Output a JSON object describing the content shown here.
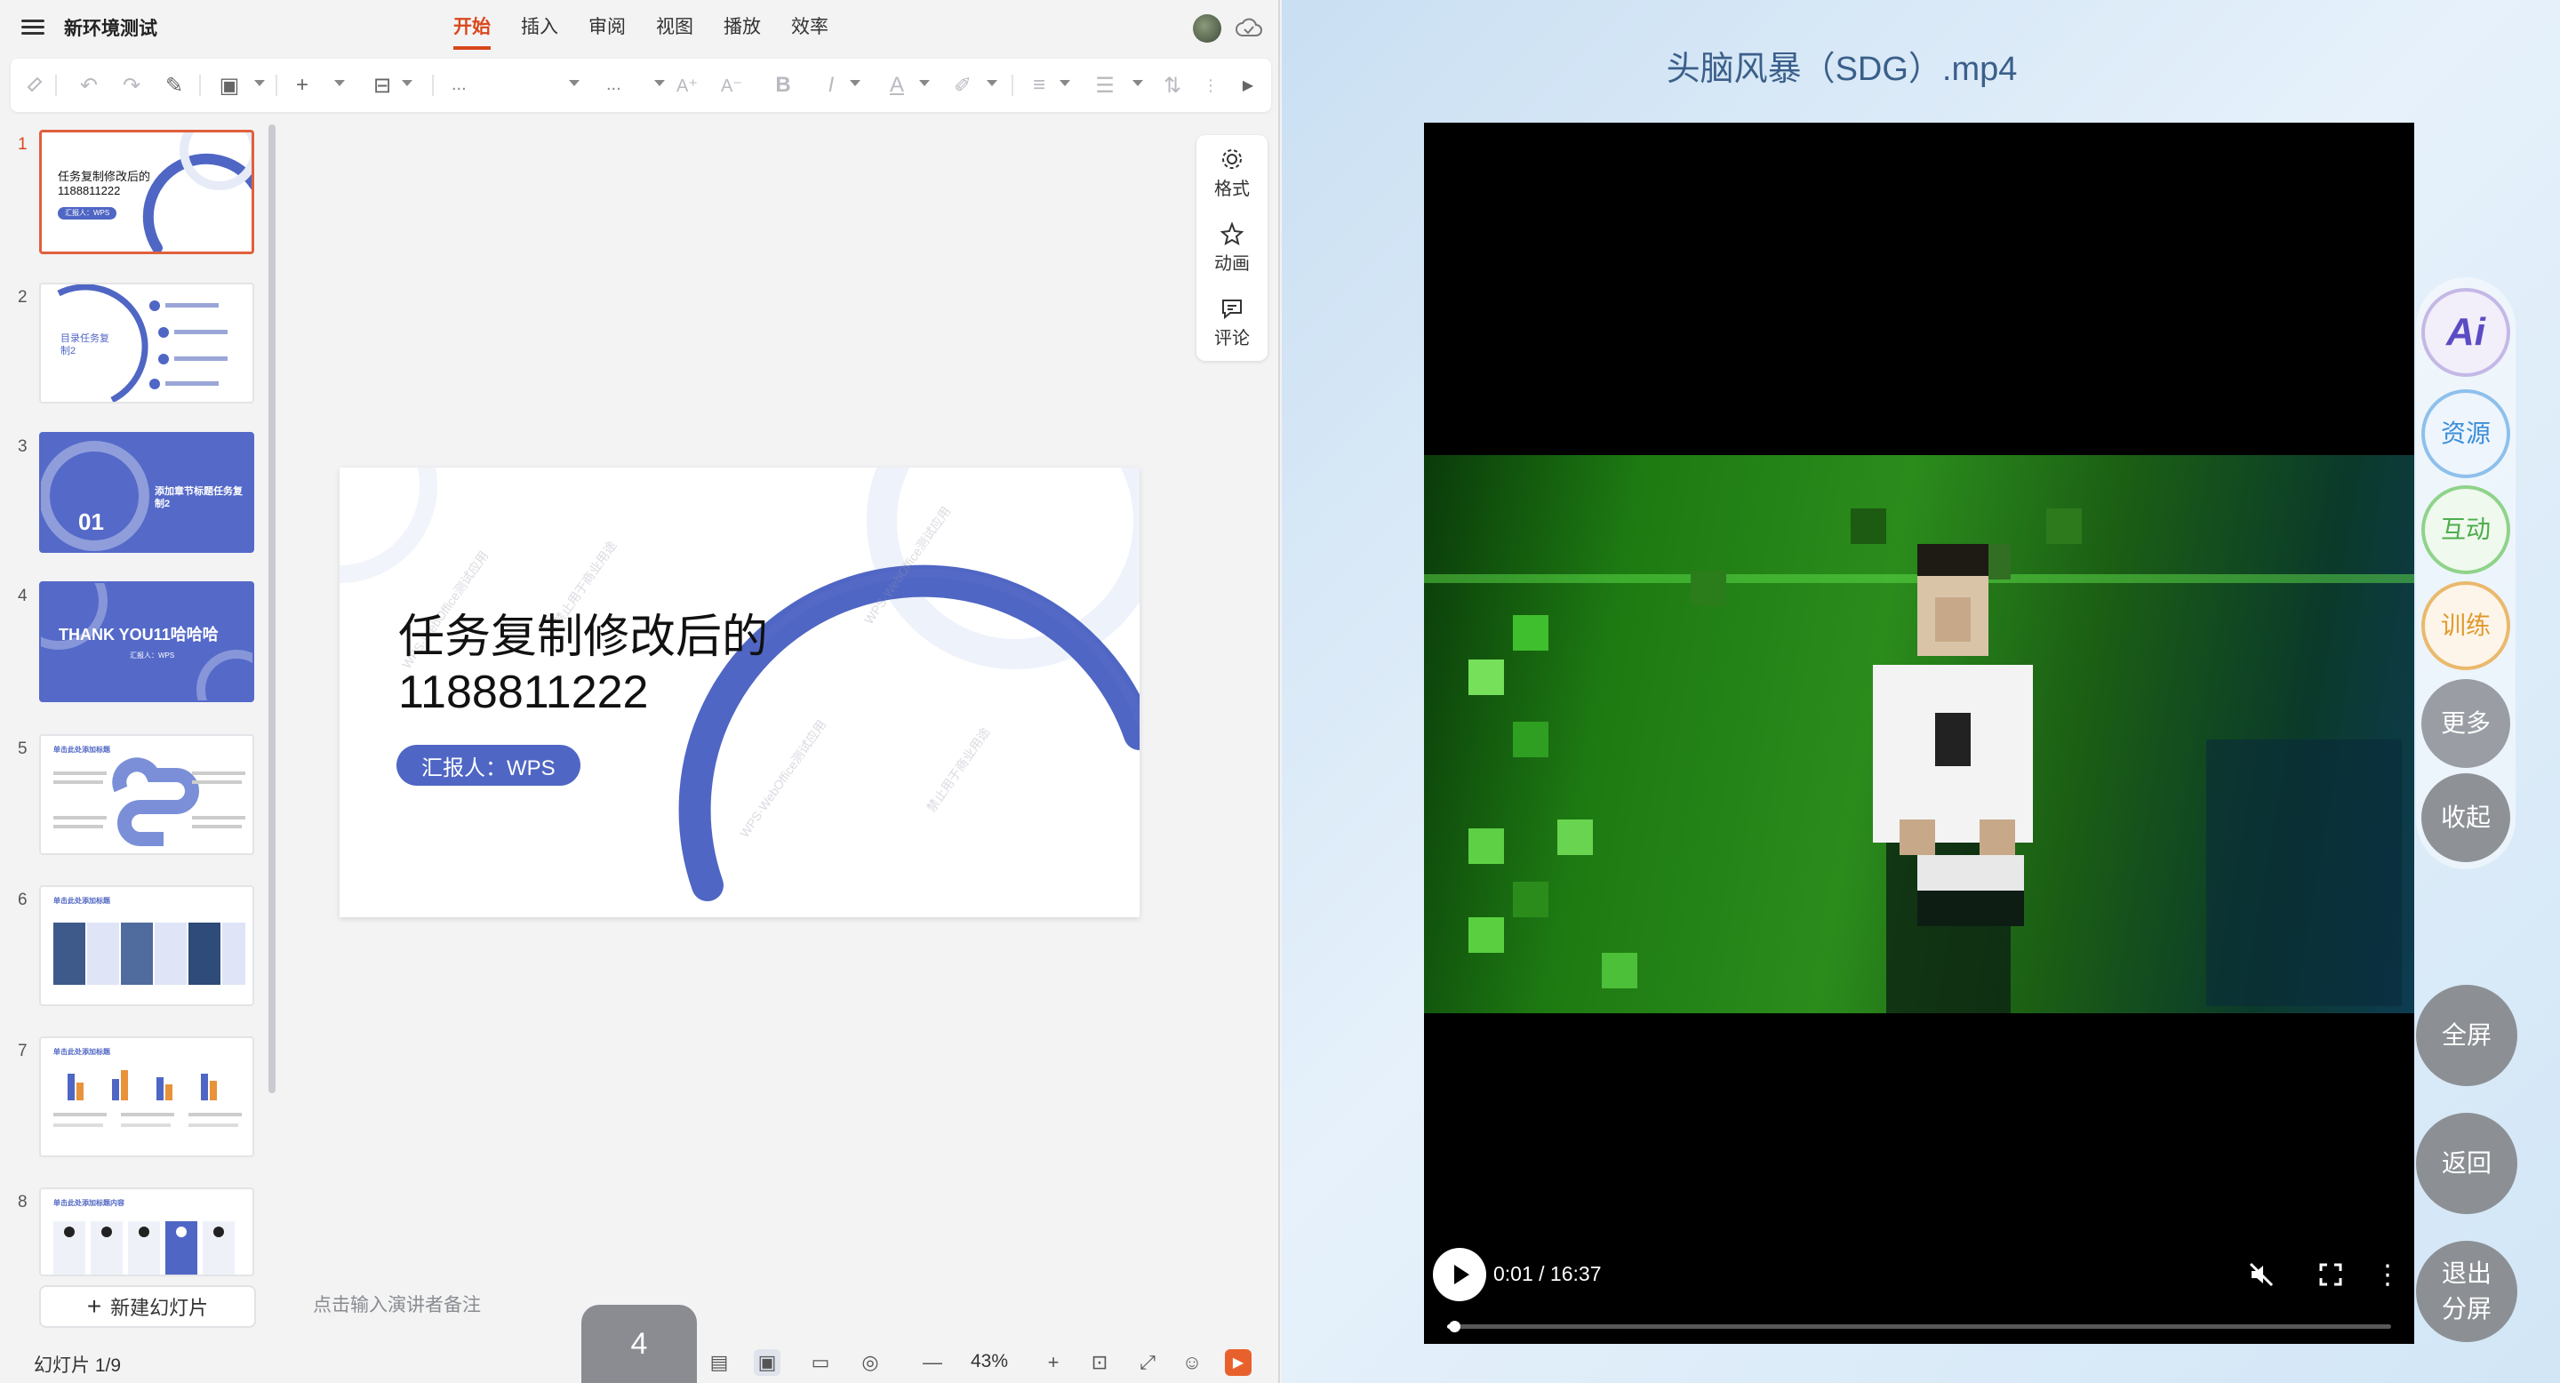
{
  "editor": {
    "doc_title": "新环境测试",
    "tabs": [
      {
        "label": "开始",
        "active": true
      },
      {
        "label": "插入",
        "active": false
      },
      {
        "label": "审阅",
        "active": false
      },
      {
        "label": "视图",
        "active": false
      },
      {
        "label": "播放",
        "active": false
      },
      {
        "label": "效率",
        "active": false
      }
    ],
    "toolbar": {
      "font_name": "...",
      "font_size": "..."
    },
    "thumbnails": [
      {
        "number": "1",
        "title": "任务复制修改后的 1188811222",
        "pill": "汇报人：WPS"
      },
      {
        "number": "2",
        "title": "目录任务复制2"
      },
      {
        "number": "3",
        "big": "01",
        "title": "添加章节标题任务复制2"
      },
      {
        "number": "4",
        "title": "THANK YOU11哈哈哈",
        "sub": "汇报人：WPS"
      },
      {
        "number": "5",
        "title": "单击此处添加标题"
      },
      {
        "number": "6",
        "title": "单击此处添加标题"
      },
      {
        "number": "7",
        "title": "单击此处添加标题"
      },
      {
        "number": "8",
        "title": "单击此处添加标题内容"
      }
    ],
    "new_slide_label": "新建幻灯片",
    "slide": {
      "title_line1": "任务复制修改后的",
      "title_line2": "1188811222",
      "pill": "汇报人：WPS",
      "watermark_1": "WPS·WebOffice测试应用",
      "watermark_2": "禁止用于商业用途"
    },
    "side_panel": [
      {
        "label": "格式",
        "icon": "gear-icon"
      },
      {
        "label": "动画",
        "icon": "star-icon"
      },
      {
        "label": "评论",
        "icon": "comment-icon"
      }
    ],
    "notes_placeholder": "点击输入演讲者备注",
    "current_page_bubble": "4",
    "status": {
      "slide_counter": "幻灯片 1/9",
      "zoom": "43%"
    }
  },
  "video": {
    "title": "头脑风暴（SDG）.mp4",
    "current_time": "0:01",
    "duration": "16:37",
    "time_display": "0:01 / 16:37",
    "progress": 0.001,
    "muted": true
  },
  "right_rail": {
    "buttons": [
      {
        "label": "Ai",
        "style": "ai"
      },
      {
        "label": "资源",
        "color": "#3b8ed8"
      },
      {
        "label": "互动",
        "color": "#4cae4c"
      },
      {
        "label": "训练",
        "color": "#e09a2e"
      },
      {
        "label": "更多"
      },
      {
        "label": "收起"
      }
    ],
    "bottom_buttons": [
      {
        "label": "全屏"
      },
      {
        "label": "返回"
      },
      {
        "label": "退出分屏"
      }
    ]
  },
  "colors": {
    "accent": "#d9471b",
    "slide_blue": "#4f66c4",
    "video_title": "#3b5f8a"
  }
}
